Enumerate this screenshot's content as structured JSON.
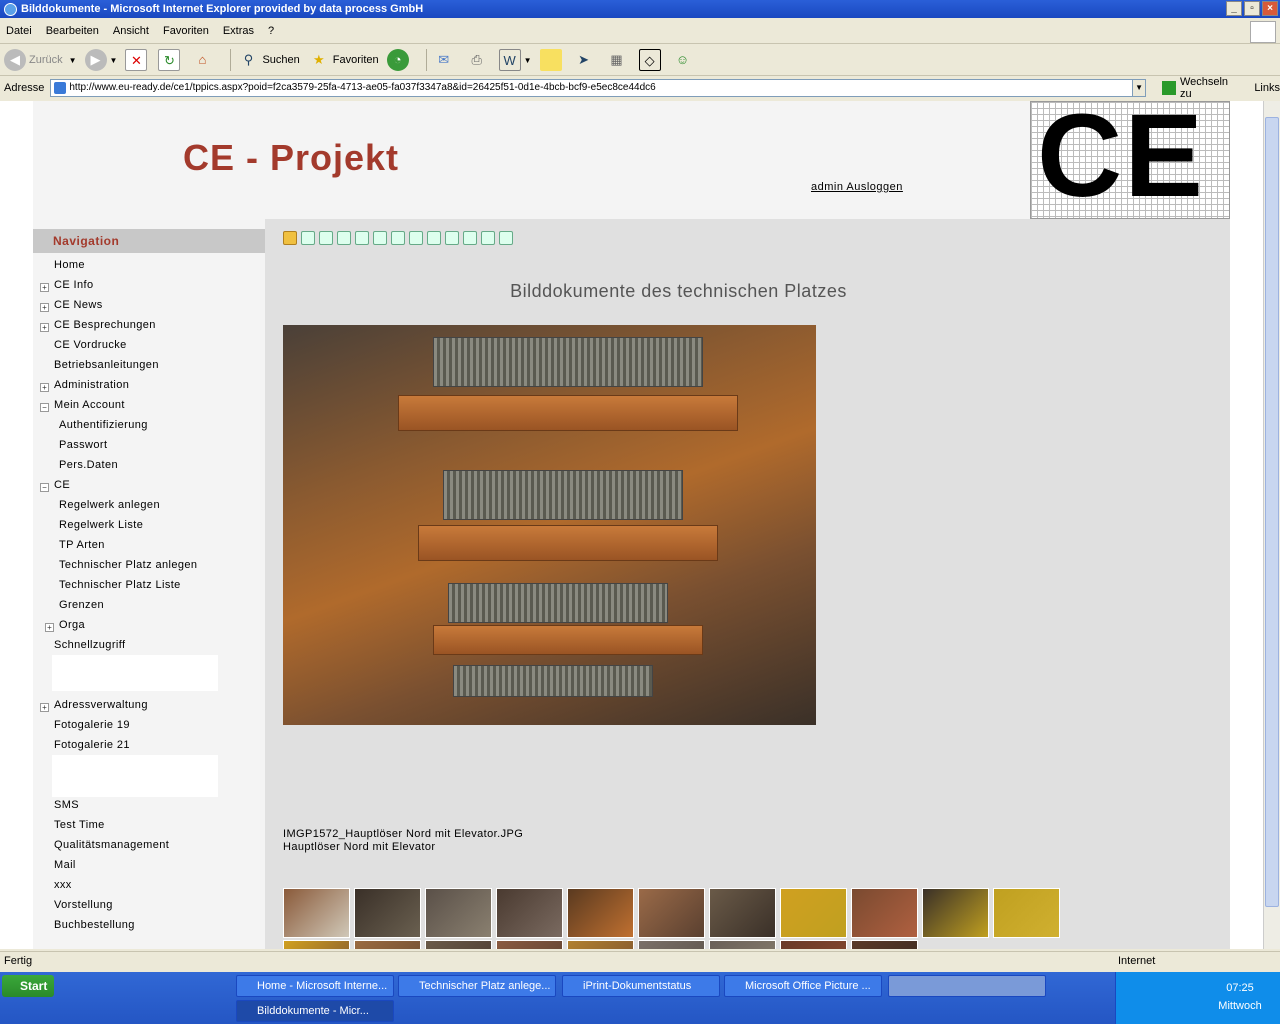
{
  "window": {
    "title": "Bilddokumente - Microsoft Internet Explorer provided by data process GmbH"
  },
  "menu": [
    "Datei",
    "Bearbeiten",
    "Ansicht",
    "Favoriten",
    "Extras",
    "?"
  ],
  "toolbar": {
    "back": "Zurück",
    "search": "Suchen",
    "favorites": "Favoriten"
  },
  "address": {
    "label": "Adresse",
    "url": "http://www.eu-ready.de/ce1/tppics.aspx?poid=f2ca3579-25fa-4713-ae05-fa037f3347a8&id=26425f51-0d1e-4bcb-bcf9-e5ec8ce44dc6",
    "go": "Wechseln zu",
    "links": "Links"
  },
  "header": {
    "title": "CE - Projekt",
    "logout": "admin Ausloggen",
    "logo_text": "CE"
  },
  "nav": {
    "heading": "Navigation",
    "items": [
      {
        "label": "Home",
        "indent": 0,
        "plus": ""
      },
      {
        "label": "CE Info",
        "indent": 0,
        "plus": "+"
      },
      {
        "label": "CE News",
        "indent": 0,
        "plus": "+"
      },
      {
        "label": "CE Besprechungen",
        "indent": 0,
        "plus": "+"
      },
      {
        "label": "CE Vordrucke",
        "indent": 0,
        "plus": ""
      },
      {
        "label": "Betriebsanleitungen",
        "indent": 0,
        "plus": ""
      },
      {
        "label": "Administration",
        "indent": 0,
        "plus": "+"
      },
      {
        "label": "Mein Account",
        "indent": 0,
        "plus": "−"
      },
      {
        "label": "Authentifizierung",
        "indent": 1,
        "plus": ""
      },
      {
        "label": "Passwort",
        "indent": 1,
        "plus": ""
      },
      {
        "label": "Pers.Daten",
        "indent": 1,
        "plus": ""
      },
      {
        "label": "CE",
        "indent": 0,
        "plus": "−"
      },
      {
        "label": "Regelwerk anlegen",
        "indent": 1,
        "plus": ""
      },
      {
        "label": "Regelwerk Liste",
        "indent": 1,
        "plus": ""
      },
      {
        "label": "TP Arten",
        "indent": 1,
        "plus": ""
      },
      {
        "label": "Technischer Platz anlegen",
        "indent": 1,
        "plus": ""
      },
      {
        "label": "Technischer Platz Liste",
        "indent": 1,
        "plus": ""
      },
      {
        "label": "Grenzen",
        "indent": 1,
        "plus": ""
      },
      {
        "label": "Orga",
        "indent": 1,
        "plus": "+"
      },
      {
        "label": "Schnellzugriff",
        "indent": 0,
        "plus": ""
      }
    ],
    "items2": [
      {
        "label": "Adressverwaltung",
        "plus": "+"
      },
      {
        "label": "Fotogalerie 19",
        "plus": ""
      },
      {
        "label": "Fotogalerie 21",
        "plus": ""
      }
    ],
    "items3": [
      "SMS",
      "Test Time",
      "Qualitätsmanagement",
      "Mail",
      "xxx",
      "Vorstellung",
      "Buchbestellung"
    ]
  },
  "content": {
    "heading": "Bilddokumente des technischen Platzes",
    "filename": "IMGP1572_Hauptlöser Nord mit Elevator.JPG",
    "description": "Hauptlöser Nord mit Elevator"
  },
  "thumbs": [
    [
      "#8a5a3a",
      "#d0c8b8"
    ],
    [
      "#3a3028",
      "#6a6050"
    ],
    [
      "#5a5048",
      "#8a8070"
    ],
    [
      "#4a3a30",
      "#7a6a60"
    ],
    [
      "#5a3a20",
      "#c07030"
    ],
    [
      "#9a6a48",
      "#5a4030"
    ],
    [
      "#6a5a48",
      "#3a3028"
    ],
    [
      "#d0a020",
      "#c0a020"
    ],
    [
      "#7a4a30",
      "#b06040"
    ],
    [
      "#3a3028",
      "#c0a020"
    ],
    [
      "#c0a020",
      "#d0b030"
    ],
    [
      "#d0a020",
      "#7a5030"
    ],
    [
      "#9a6a40",
      "#6a4a30"
    ],
    [
      "#6a5a48",
      "#4a3a30"
    ],
    [
      "#8a5a40",
      "#5a4030"
    ],
    [
      "#b08030",
      "#7a5030"
    ],
    [
      "#7a7068",
      "#5a5048"
    ],
    [
      "#6a6058",
      "#8a8070"
    ],
    [
      "#6a3a28",
      "#8a4a30"
    ],
    [
      "#5a3a28",
      "#3a2820"
    ]
  ],
  "status": {
    "left": "Fertig",
    "zone": "Internet"
  },
  "taskbar": {
    "start": "Start",
    "tasks": [
      "Home - Microsoft Interne...",
      "Technischer Platz anlege...",
      "iPrint-Dokumentstatus",
      "Microsoft Office Picture ..."
    ],
    "active": "Bilddokumente - Micr...",
    "time": "07:25",
    "day": "Mittwoch"
  }
}
